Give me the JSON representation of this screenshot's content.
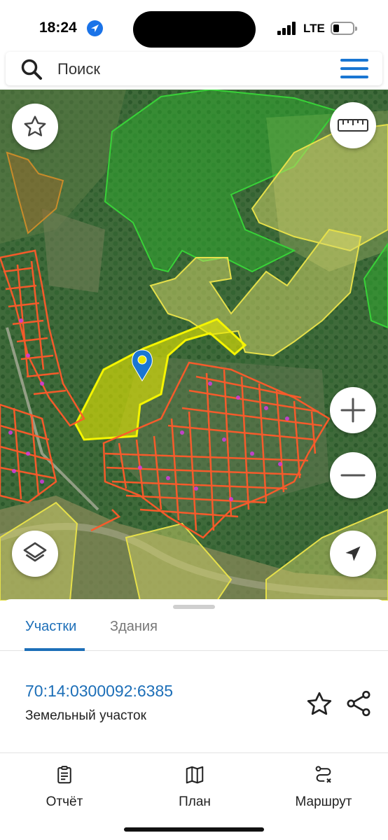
{
  "status_bar": {
    "time": "18:24",
    "network": "LTE"
  },
  "search": {
    "placeholder": "Поиск"
  },
  "map": {
    "icons": {
      "favorites": "star-outline-icon",
      "ruler": "ruler-icon",
      "zoom_in": "plus-icon",
      "zoom_out": "minus-icon",
      "layers": "layers-icon",
      "location": "navigation-arrow-icon",
      "marker": "location-pin-icon"
    },
    "colors": {
      "forest_parcel": "#2fb52f",
      "farmland_parcel": "#e6e04a",
      "building_parcel": "#ff5a2a",
      "selected_parcel": "#e8e800",
      "marker": "#1976d2"
    }
  },
  "tabs": [
    {
      "label": "Участки",
      "active": true
    },
    {
      "label": "Здания",
      "active": false
    }
  ],
  "result": {
    "cadastral_number": "70:14:0300092:6385",
    "type": "Земельный участок"
  },
  "bottom_nav": [
    {
      "label": "Отчёт",
      "icon": "clipboard-icon"
    },
    {
      "label": "План",
      "icon": "map-icon"
    },
    {
      "label": "Маршрут",
      "icon": "route-icon"
    }
  ],
  "colors": {
    "accent": "#1d6fb8"
  }
}
